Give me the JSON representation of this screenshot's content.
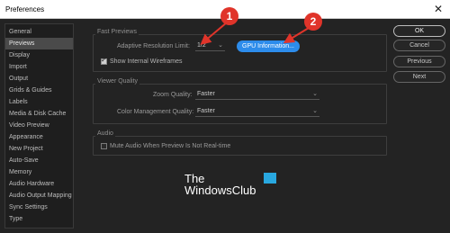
{
  "window": {
    "title": "Preferences",
    "close_glyph": "✕"
  },
  "sidebar": {
    "items": [
      {
        "label": "General",
        "active": false
      },
      {
        "label": "Previews",
        "active": true
      },
      {
        "label": "Display",
        "active": false
      },
      {
        "label": "Import",
        "active": false
      },
      {
        "label": "Output",
        "active": false
      },
      {
        "label": "Grids & Guides",
        "active": false
      },
      {
        "label": "Labels",
        "active": false
      },
      {
        "label": "Media & Disk Cache",
        "active": false
      },
      {
        "label": "Video Preview",
        "active": false
      },
      {
        "label": "Appearance",
        "active": false
      },
      {
        "label": "New Project",
        "active": false
      },
      {
        "label": "Auto-Save",
        "active": false
      },
      {
        "label": "Memory",
        "active": false
      },
      {
        "label": "Audio Hardware",
        "active": false
      },
      {
        "label": "Audio Output Mapping",
        "active": false
      },
      {
        "label": "Sync Settings",
        "active": false
      },
      {
        "label": "Type",
        "active": false
      }
    ]
  },
  "fast_previews": {
    "section_title": "Fast Previews",
    "adaptive_label": "Adaptive Resolution Limit:",
    "adaptive_value": "1/2",
    "gpu_button": "GPU Information...",
    "wireframes_label": "Show Internal Wireframes",
    "wireframes_checked": true
  },
  "viewer_quality": {
    "section_title": "Viewer Quality",
    "zoom_label": "Zoom Quality:",
    "zoom_value": "Faster",
    "color_label": "Color Management Quality:",
    "color_value": "Faster"
  },
  "audio": {
    "section_title": "Audio",
    "mute_label": "Mute Audio When Preview Is Not Real-time",
    "mute_checked": false
  },
  "buttons": {
    "ok": "OK",
    "cancel": "Cancel",
    "previous": "Previous",
    "next": "Next"
  },
  "annotations": {
    "badge1": "1",
    "badge2": "2",
    "badge_color": "#e0342a",
    "arrow_color": "#e0342a"
  },
  "watermark": {
    "line1": "The",
    "line2": "WindowsClub"
  },
  "colors": {
    "accent": "#2d8ceb",
    "background": "#232323"
  }
}
